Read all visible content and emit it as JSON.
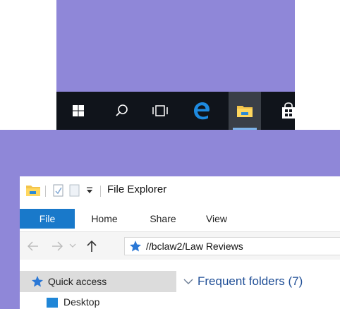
{
  "taskbar": {
    "buttons": [
      {
        "name": "start-button",
        "icon": "windows-icon"
      },
      {
        "name": "search-button",
        "icon": "search-icon"
      },
      {
        "name": "task-view-button",
        "icon": "task-view-icon"
      },
      {
        "name": "edge-button",
        "icon": "edge-icon"
      },
      {
        "name": "file-explorer-button",
        "icon": "folder-icon",
        "active": true
      },
      {
        "name": "store-button",
        "icon": "store-icon"
      }
    ]
  },
  "window": {
    "title": "File Explorer",
    "ribbon_tabs": [
      "File",
      "Home",
      "Share",
      "View"
    ]
  },
  "address": {
    "path": "//bclaw2/Law Reviews"
  },
  "nav_pane": {
    "quick_access": "Quick access",
    "next_item": "Desktop"
  },
  "main": {
    "section_header": "Frequent folders (7)"
  },
  "colors": {
    "desktop": "#8f87d8",
    "taskbar": "#10141b",
    "file_tab": "#1979ca",
    "accent_pin": "#2b78d6"
  }
}
